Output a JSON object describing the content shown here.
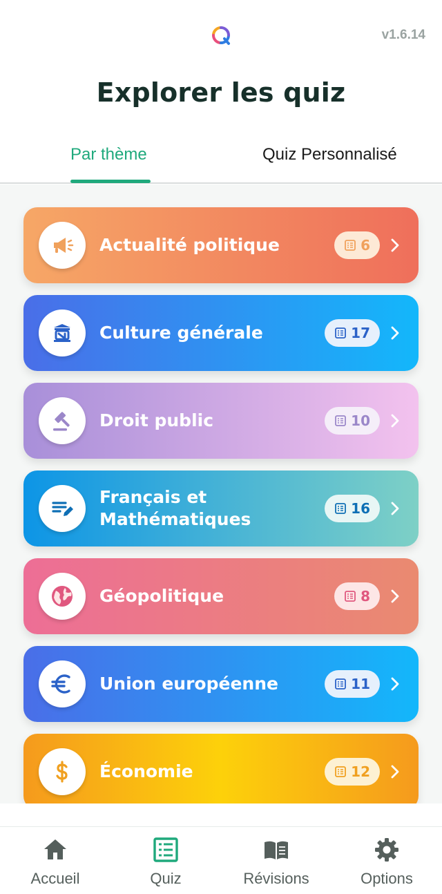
{
  "app": {
    "version": "v1.6.14",
    "logo_icon": "quiz-logo-icon"
  },
  "page": {
    "title": "Explorer les quiz"
  },
  "tabs": [
    {
      "label": "Par thème",
      "active": true
    },
    {
      "label": "Quiz Personnalisé",
      "active": false
    }
  ],
  "themes": [
    {
      "label": "Actualité politique",
      "count": "6",
      "icon": "megaphone-icon",
      "gradient": [
        "#f6a766",
        "#ef6f5b"
      ],
      "accent": "#f0a15c",
      "badge_bg": "#fde9d6"
    },
    {
      "label": "Culture générale",
      "count": "17",
      "icon": "museum-icon",
      "gradient": [
        "#4a6ee8",
        "#13b7fb"
      ],
      "accent": "#2b62c8",
      "badge_bg": "#e6f0fc"
    },
    {
      "label": "Droit public",
      "count": "10",
      "icon": "gavel-icon",
      "gradient": [
        "#a88fd9",
        "#f3c2ee"
      ],
      "accent": "#9b87c9",
      "badge_bg": "#f5eef9"
    },
    {
      "label": "Français et Mathématiques",
      "count": "16",
      "icon": "edit-notes-icon",
      "gradient": [
        "#0d95e6",
        "#7ed0c6"
      ],
      "accent": "#0e6fb5",
      "badge_bg": "#e8f6f5"
    },
    {
      "label": "Géopolitique",
      "count": "8",
      "icon": "globe-icon",
      "gradient": [
        "#ed6e96",
        "#ea8a70"
      ],
      "accent": "#e0587f",
      "badge_bg": "#fde6e6"
    },
    {
      "label": "Union européenne",
      "count": "11",
      "icon": "euro-icon",
      "gradient": [
        "#4a6ee8",
        "#13b7fb"
      ],
      "accent": "#2b62c8",
      "badge_bg": "#e6f0fc"
    },
    {
      "label": "Économie",
      "count": "12",
      "icon": "dollar-icon",
      "gradient": [
        "#f59a1d",
        "#fdd10a",
        "#f59a1d"
      ],
      "accent": "#f0a020",
      "badge_bg": "#fdf1d3"
    }
  ],
  "nav": [
    {
      "label": "Accueil",
      "icon": "home-icon",
      "active": false
    },
    {
      "label": "Quiz",
      "icon": "list-icon",
      "active": true
    },
    {
      "label": "Révisions",
      "icon": "book-icon",
      "active": false
    },
    {
      "label": "Options",
      "icon": "gear-icon",
      "active": false
    }
  ],
  "colors": {
    "primary": "#1fa97c",
    "title": "#17302a",
    "version": "#9aa3a1"
  }
}
